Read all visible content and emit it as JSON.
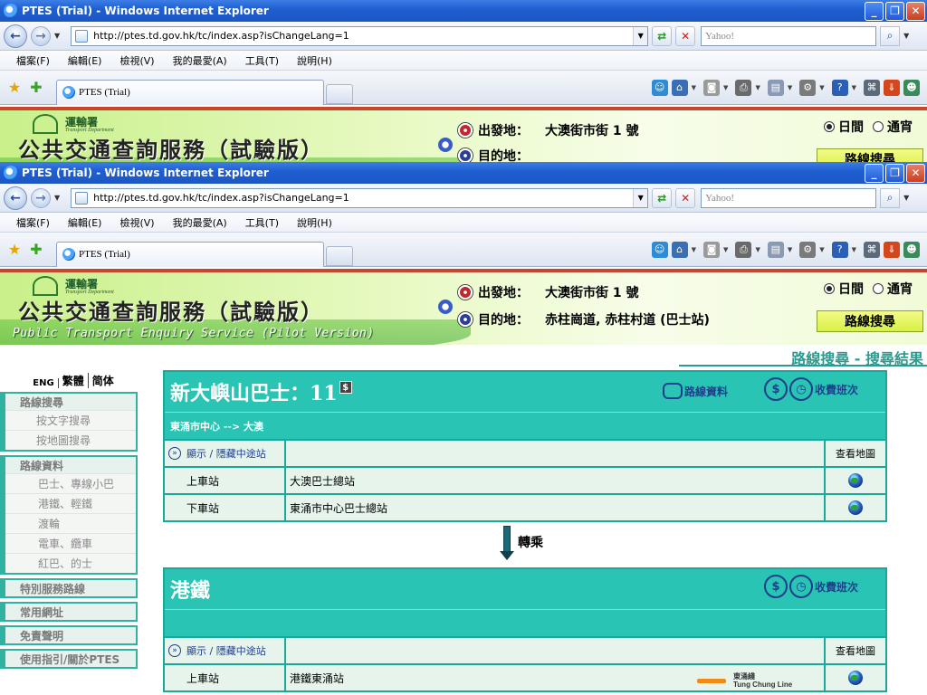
{
  "browser": {
    "title": "PTES (Trial) - Windows Internet Explorer",
    "url": "http://ptes.td.gov.hk/tc/index.asp?isChangeLang=1",
    "search_placeholder": "Yahoo!",
    "menu": [
      "檔案(F)",
      "編輯(E)",
      "檢視(V)",
      "我的最愛(A)",
      "工具(T)",
      "說明(H)"
    ],
    "tab_title": "PTES (Trial)"
  },
  "header": {
    "dept_cn": "運輸署",
    "dept_en": "Transport Department",
    "title_cn": "公共交通查詢服務（試驗版）",
    "title_en": "Public Transport Enquiry Service (Pilot Version)",
    "origin_label": "出發地：",
    "origin_value": "大澳街市街 1 號",
    "dest_label": "目的地：",
    "dest_value": "赤柱崗道, 赤柱村道 (巴士站)",
    "day_label": "日間",
    "night_label": "通宵",
    "search_button": "路線搜尋"
  },
  "breadcrumb": "路線搜尋 - 搜尋結果",
  "sidebar": {
    "lang": [
      "ENG",
      "繁體",
      "简体"
    ],
    "sections": [
      {
        "head": "路線搜尋",
        "items": [
          "按文字搜尋",
          "按地圖搜尋"
        ]
      },
      {
        "head": "路線資料",
        "items": [
          "巴士、專線小巴",
          "港鐵、輕鐵",
          "渡輪",
          "電車、纜車",
          "紅巴、的士"
        ]
      },
      {
        "head": "特別服務路線",
        "items": []
      },
      {
        "head": "常用網址",
        "items": []
      },
      {
        "head": "免責聲明",
        "items": []
      },
      {
        "head": "使用指引/關於PTES",
        "items": []
      }
    ]
  },
  "route1": {
    "title": "新大嶼山巴士：11",
    "fare_badge": "$",
    "info_link": "路線資料",
    "fare_link": "收費班次",
    "direction": "東涌市中心 --> 大澳",
    "toggle_stops": "顯示 / 隱藏中途站",
    "map_header": "查看地圖",
    "board_label": "上車站",
    "board_stop": "大澳巴士總站",
    "alight_label": "下車站",
    "alight_stop": "東涌市中心巴士總站"
  },
  "transfer_label": "轉乘",
  "route2": {
    "title": "港鐵",
    "fare_link": "收費班次",
    "toggle_stops": "顯示 / 隱藏中途站",
    "map_header": "查看地圖",
    "board_label": "上車站",
    "board_stop": "港鐵東涌站",
    "line_cn": "東涌綫",
    "line_en": "Tung Chung Line",
    "line_color": "#f28a16"
  }
}
